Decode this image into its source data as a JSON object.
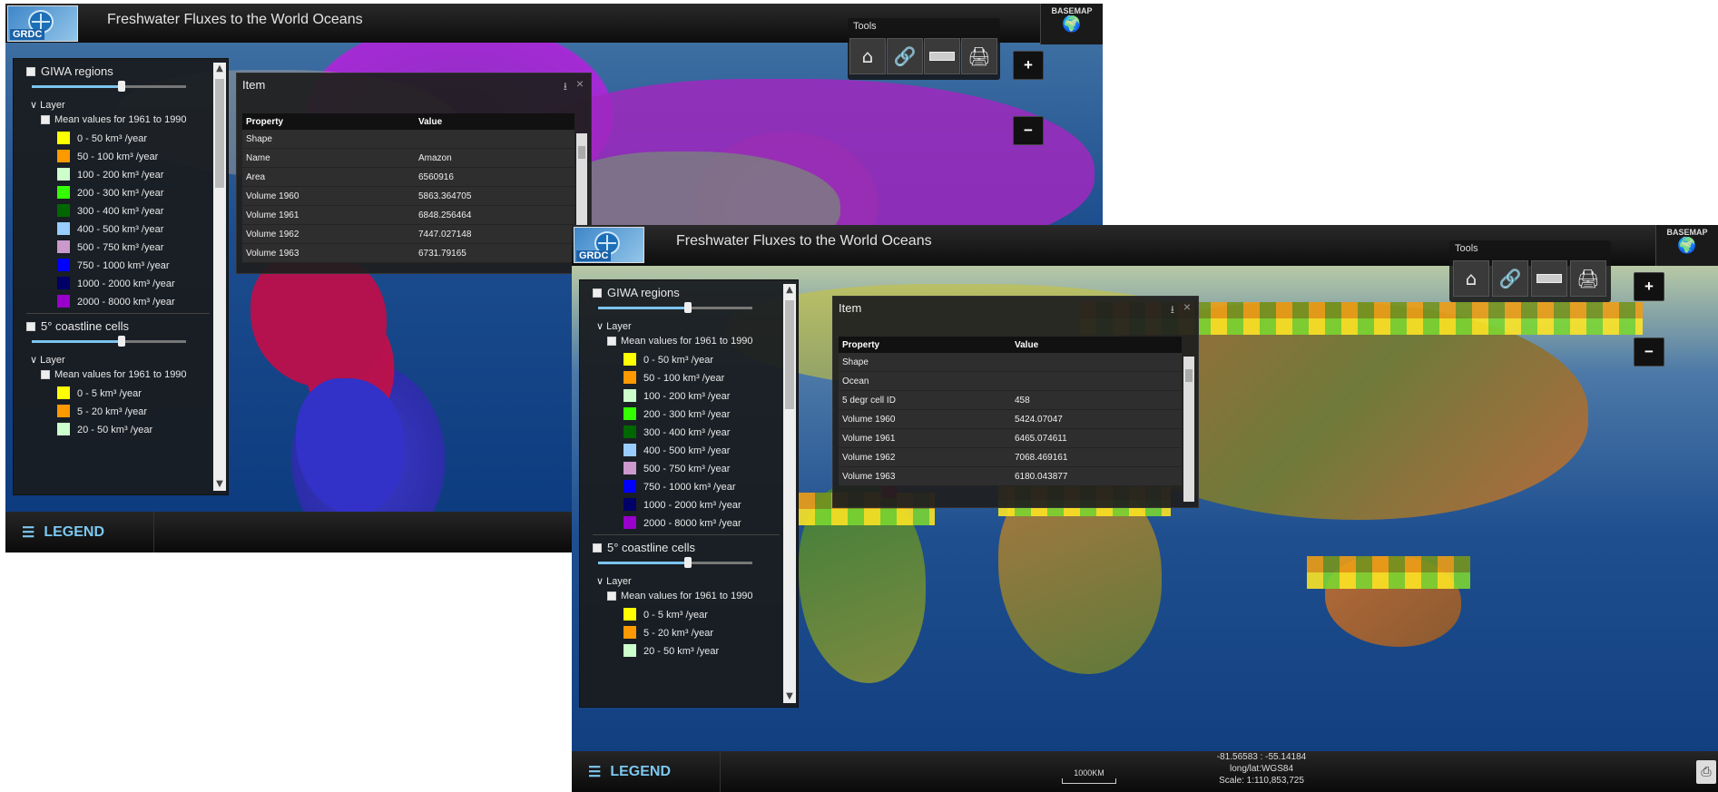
{
  "windows": [
    {
      "title": "Freshwater Fluxes to the World Oceans",
      "logo_text": "GRDC",
      "basemap_label": "BASEMAP",
      "tools_label": "Tools",
      "tool_buttons": [
        "home-icon",
        "link-icon",
        "measure-icon",
        "print-icon"
      ],
      "zoom_in": "+",
      "zoom_out": "−",
      "legend": {
        "groups": [
          {
            "title": "GIWA regions",
            "slider_fraction": 0.58,
            "layer_label": "Layer",
            "mean_label": "Mean values for 1961 to 1990",
            "items": [
              {
                "label": "0 - 50 km³ /year",
                "color": "#ffff00"
              },
              {
                "label": "50 - 100 km³ /year",
                "color": "#ff9900"
              },
              {
                "label": "100 - 200 km³ /year",
                "color": "#ccffcc"
              },
              {
                "label": "200 - 300 km³ /year",
                "color": "#33ff00"
              },
              {
                "label": "300 - 400 km³ /year",
                "color": "#006600"
              },
              {
                "label": "400 - 500 km³ /year",
                "color": "#99ccff"
              },
              {
                "label": "500 - 750 km³ /year",
                "color": "#cc99cc"
              },
              {
                "label": "750 - 1000 km³ /year",
                "color": "#0000ff"
              },
              {
                "label": "1000 - 2000 km³ /year",
                "color": "#000066"
              },
              {
                "label": "2000 - 8000 km³ /year",
                "color": "#9900cc"
              }
            ]
          },
          {
            "title": "5° coastline cells",
            "slider_fraction": 0.58,
            "layer_label": "Layer",
            "mean_label": "Mean values for 1961 to 1990",
            "items": [
              {
                "label": "0 - 5 km³ /year",
                "color": "#ffff00"
              },
              {
                "label": "5 - 20 km³ /year",
                "color": "#ff9900"
              },
              {
                "label": "20 - 50 km³ /year",
                "color": "#ccffcc"
              }
            ]
          }
        ]
      },
      "popup": {
        "title": "Item",
        "col_property": "Property",
        "col_value": "Value",
        "rows": [
          {
            "p": "Shape",
            "v": ""
          },
          {
            "p": "Name",
            "v": "Amazon"
          },
          {
            "p": "Area",
            "v": "6560916"
          },
          {
            "p": "Volume 1960",
            "v": "5863.364705"
          },
          {
            "p": "Volume 1961",
            "v": "6848.256464"
          },
          {
            "p": "Volume 1962",
            "v": "7447.027148"
          },
          {
            "p": "Volume 1963",
            "v": "6731.79165"
          }
        ]
      },
      "footer": {
        "legend_label": "LEGEND"
      }
    },
    {
      "title": "Freshwater Fluxes to the World Oceans",
      "logo_text": "GRDC",
      "basemap_label": "BASEMAP",
      "tools_label": "Tools",
      "tool_buttons": [
        "home-icon",
        "link-icon",
        "measure-icon",
        "print-icon"
      ],
      "zoom_in": "+",
      "zoom_out": "−",
      "legend": {
        "groups": [
          {
            "title": "GIWA regions",
            "slider_fraction": 0.58,
            "layer_label": "Layer",
            "mean_label": "Mean values for 1961 to 1990",
            "items": [
              {
                "label": "0 - 50 km³ /year",
                "color": "#ffff00"
              },
              {
                "label": "50 - 100 km³ /year",
                "color": "#ff9900"
              },
              {
                "label": "100 - 200 km³ /year",
                "color": "#ccffcc"
              },
              {
                "label": "200 - 300 km³ /year",
                "color": "#33ff00"
              },
              {
                "label": "300 - 400 km³ /year",
                "color": "#006600"
              },
              {
                "label": "400 - 500 km³ /year",
                "color": "#99ccff"
              },
              {
                "label": "500 - 750 km³ /year",
                "color": "#cc99cc"
              },
              {
                "label": "750 - 1000 km³ /year",
                "color": "#0000ff"
              },
              {
                "label": "1000 - 2000 km³ /year",
                "color": "#000066"
              },
              {
                "label": "2000 - 8000 km³ /year",
                "color": "#9900cc"
              }
            ]
          },
          {
            "title": "5° coastline cells",
            "slider_fraction": 0.58,
            "layer_label": "Layer",
            "mean_label": "Mean values for 1961 to 1990",
            "items": [
              {
                "label": "0 - 5 km³ /year",
                "color": "#ffff00"
              },
              {
                "label": "5 - 20 km³ /year",
                "color": "#ff9900"
              },
              {
                "label": "20 - 50 km³ /year",
                "color": "#ccffcc"
              }
            ]
          }
        ]
      },
      "popup": {
        "title": "Item",
        "col_property": "Property",
        "col_value": "Value",
        "rows": [
          {
            "p": "Shape",
            "v": ""
          },
          {
            "p": "Ocean",
            "v": ""
          },
          {
            "p": "5 degr cell ID",
            "v": "458"
          },
          {
            "p": "Volume 1960",
            "v": "5424.07047"
          },
          {
            "p": "Volume 1961",
            "v": "6465.074611"
          },
          {
            "p": "Volume 1962",
            "v": "7068.469161"
          },
          {
            "p": "Volume 1963",
            "v": "6180.043877"
          }
        ]
      },
      "footer": {
        "legend_label": "LEGEND",
        "scale_bar_label": "1000KM",
        "coords": "-81.56583 : -55.14184",
        "projection": "long/lat:WGS84",
        "scale": "Scale: 1:110,853,725"
      }
    }
  ]
}
